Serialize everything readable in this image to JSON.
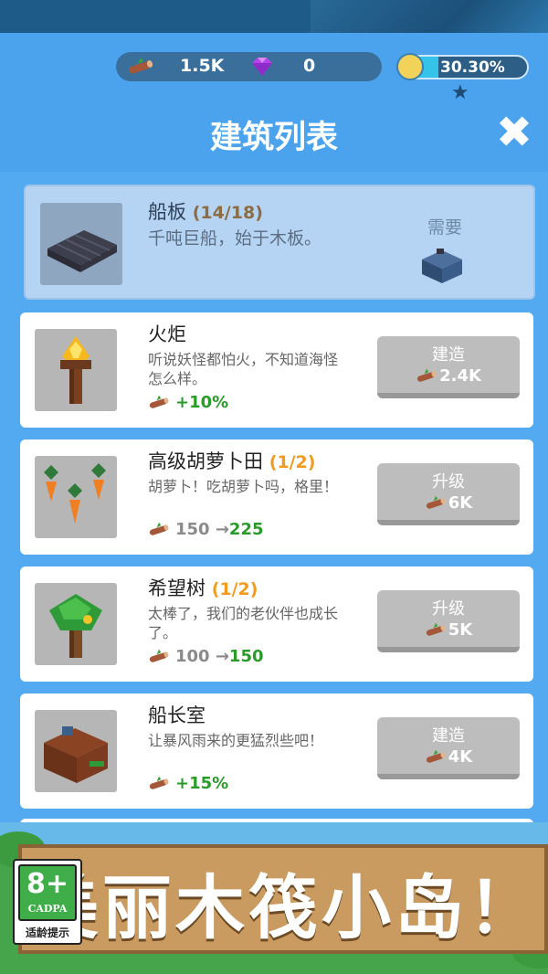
{
  "hud": {
    "wood_amount": "1.5K",
    "gem_amount": "0",
    "island_progress": "30.30%",
    "island_progress_fraction": 0.303
  },
  "header": {
    "title": "建筑列表",
    "close_icon": "close-icon"
  },
  "featured": {
    "name": "船板",
    "count": "(14/18)",
    "desc": "千吨巨船，始于木板。",
    "need_label": "需要"
  },
  "cards": [
    {
      "name": "火炬",
      "level": "",
      "desc": "听说妖怪都怕火，不知道海怪怎么样。",
      "stat_old": "",
      "stat_new": "+10%",
      "button_label": "建造",
      "cost": "2.4K"
    },
    {
      "name": "高级胡萝卜田",
      "level": "(1/2)",
      "desc": "胡萝卜！吃胡萝卜吗，格里！",
      "stat_old": "150 →",
      "stat_new": "225",
      "button_label": "升级",
      "cost": "6K"
    },
    {
      "name": "希望树",
      "level": "(1/2)",
      "desc": "太棒了，我们的老伙伴也成长了。",
      "stat_old": "100 →",
      "stat_new": "150",
      "button_label": "升级",
      "cost": "5K"
    },
    {
      "name": "船长室",
      "level": "",
      "desc": "让暴风雨来的更猛烈些吧！",
      "stat_old": "",
      "stat_new": "+15%",
      "button_label": "建造",
      "cost": "4K"
    }
  ],
  "banner": {
    "text": "美丽木筏小岛！",
    "age_rating": "8+",
    "age_brand": "CADPA",
    "age_tip": "适龄提示"
  },
  "colors": {
    "accent_green": "#2a9a2a",
    "level_orange": "#f19b21",
    "panel_blue": "#54aaf0"
  }
}
